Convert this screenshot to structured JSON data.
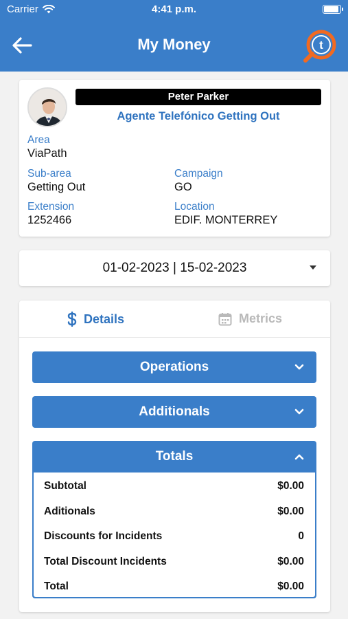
{
  "status_bar": {
    "carrier": "Carrier",
    "time": "4:41 p.m."
  },
  "header": {
    "title": "My Money",
    "back_icon": "arrow-left-icon",
    "logo_icon": "t-logo-icon"
  },
  "profile": {
    "name": "Peter Parker",
    "role": "Agente Telefónico Getting Out",
    "area_label": "Area",
    "area_value": "ViaPath",
    "subarea_label": "Sub-area",
    "subarea_value": "Getting Out",
    "campaign_label": "Campaign",
    "campaign_value": "GO",
    "extension_label": "Extension",
    "extension_value": "1252466",
    "location_label": "Location",
    "location_value": "EDIF. MONTERREY"
  },
  "date_range": {
    "value": "01-02-2023 | 15-02-2023"
  },
  "tabs": [
    {
      "label": "Details",
      "icon": "dollar-icon",
      "active": true
    },
    {
      "label": "Metrics",
      "icon": "calendar-icon",
      "active": false
    }
  ],
  "sections": {
    "operations": "Operations",
    "additionals": "Additionals",
    "totals": "Totals"
  },
  "totals": [
    {
      "label": "Subtotal",
      "value": "$0.00"
    },
    {
      "label": "Aditionals",
      "value": "$0.00"
    },
    {
      "label": "Discounts for Incidents",
      "value": "0"
    },
    {
      "label": "Total Discount Incidents",
      "value": "$0.00"
    },
    {
      "label": "Total",
      "value": "$0.00"
    }
  ],
  "colors": {
    "primary": "#3a7ec9",
    "link": "#2f73bf",
    "inactive": "#b9b9b9",
    "logo_orange": "#f26a21"
  }
}
